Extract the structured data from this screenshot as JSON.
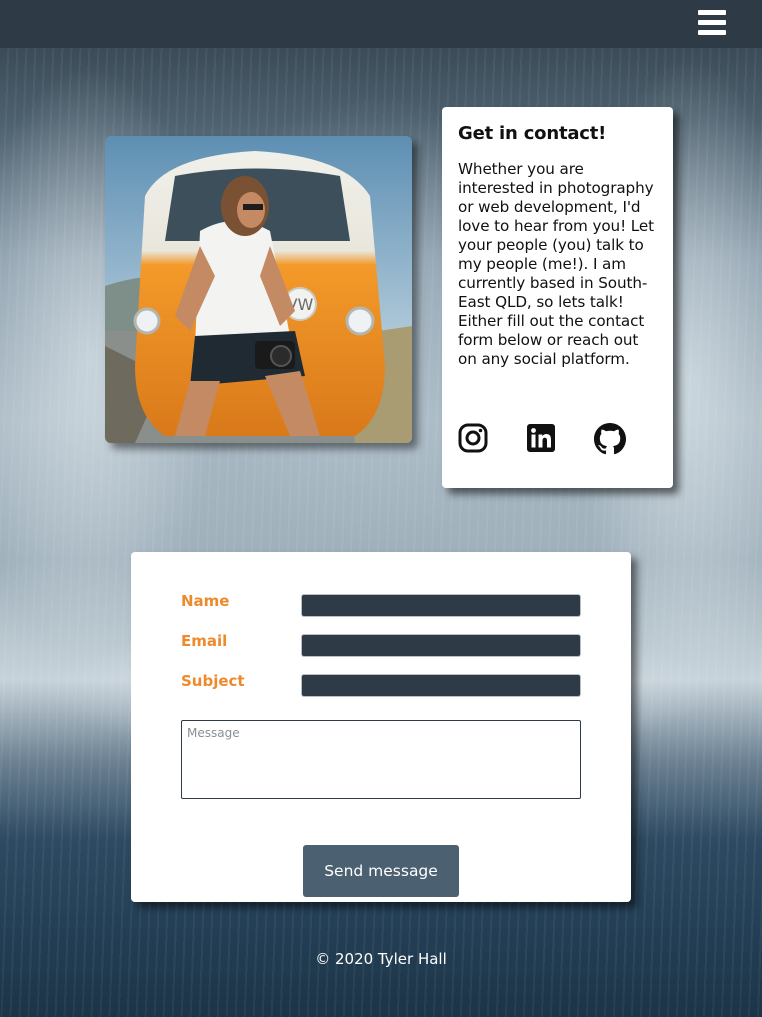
{
  "navbar": {
    "menu_icon": "hamburger-menu-icon"
  },
  "photo": {
    "subject": "man sitting on front of orange van holding camera"
  },
  "contact": {
    "title": "Get in contact!",
    "body": "Whether you are interested in photography or web development, I'd love to hear from you! Let your people (you) talk to my people (me!). I am currently based in South-East QLD, so lets talk! Either fill out the contact form below or reach out on any social platform.",
    "social": [
      {
        "icon": "instagram-icon"
      },
      {
        "icon": "linkedin-icon"
      },
      {
        "icon": "github-icon"
      }
    ]
  },
  "form": {
    "name_label": "Name",
    "name_value": "",
    "email_label": "Email",
    "email_value": "",
    "subject_label": "Subject",
    "subject_value": "",
    "message_placeholder": "Message",
    "message_value": "",
    "send_label": "Send message"
  },
  "footer": {
    "copyright": "© 2020 Tyler Hall"
  },
  "colors": {
    "navbar": "#2e3a46",
    "label_accent": "#ee8a2c",
    "button": "#4b6070",
    "input_bg": "#2e3a46"
  }
}
